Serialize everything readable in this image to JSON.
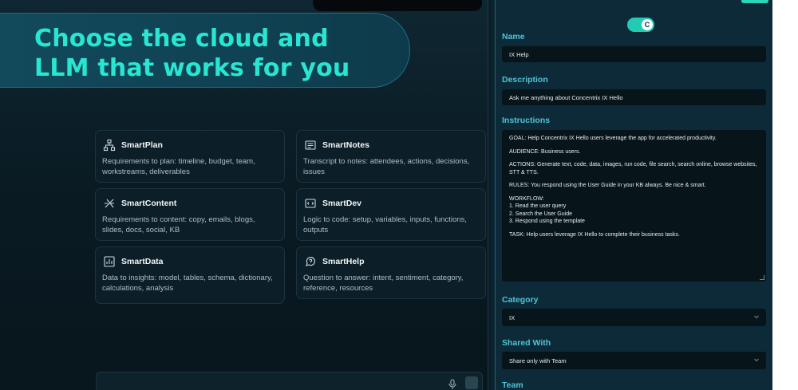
{
  "hero": {
    "title_line1": "Choose the cloud and",
    "title_line2": "LLM that works for you"
  },
  "cards": [
    {
      "icon": "org-chart-icon",
      "title": "SmartPlan",
      "desc": "Requirements to plan: timeline, budget, team, workstreams, deliverables"
    },
    {
      "icon": "notes-icon",
      "title": "SmartNotes",
      "desc": "Transcript to notes: attendees, actions, decisions, issues"
    },
    {
      "icon": "content-icon",
      "title": "SmartContent",
      "desc": "Requirements to content: copy, emails, blogs, slides, docs, social, KB"
    },
    {
      "icon": "code-icon",
      "title": "SmartDev",
      "desc": "Logic to code: setup, variables, inputs, functions, outputs"
    },
    {
      "icon": "bar-chart-icon",
      "title": "SmartData",
      "desc": "Data to insights: model, tables, schema, dictionary, calculations, analysis"
    },
    {
      "icon": "help-icon",
      "title": "SmartHelp",
      "desc": "Question to answer: intent, sentiment, category, reference, resources"
    }
  ],
  "config": {
    "toggle_knob": "C",
    "name_label": "Name",
    "name_value": "IX Help",
    "description_label": "Description",
    "description_value": "Ask me anything about Concentrix IX Hello",
    "instructions_label": "Instructions",
    "instructions": {
      "goal": "GOAL: Help Concentrix IX Hello users leverage the app for accelerated productivity.",
      "audience": "AUDIENCE: Business users.",
      "actions": "ACTIONS: Generate text, code, data, images, run code, file search, search online, browse websites, STT & TTS.",
      "rules": "RULES: You respond using the User Guide in your KB always. Be nice & smart.",
      "workflow_title": "WORKFLOW:",
      "workflow_1": "1. Read the user query",
      "workflow_2": "2. Search the User Guide",
      "workflow_3": "3. Respond using the template",
      "task": "TASK: Help users leverage IX Hello to complete their business tasks."
    },
    "category_label": "Category",
    "category_value": "IX",
    "shared_label": "Shared With",
    "shared_value": "Share only with Team",
    "team_label": "Team"
  },
  "colors": {
    "accent": "#28e6d2",
    "label": "#4fc4d8",
    "panel": "#0c2a37",
    "background": "#0a1b23"
  }
}
